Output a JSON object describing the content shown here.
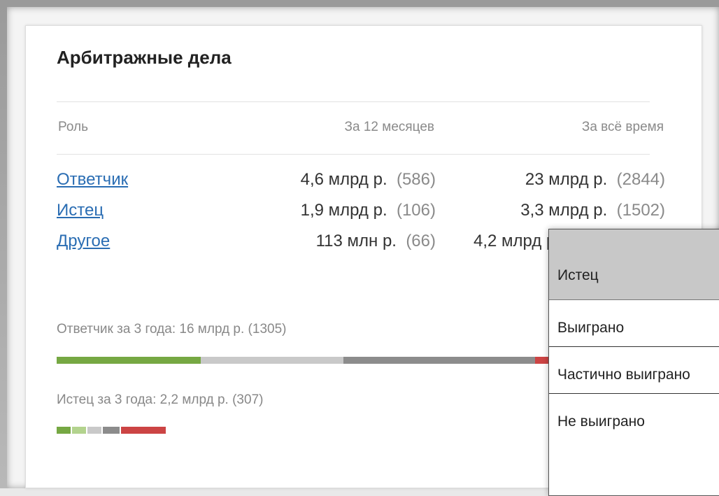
{
  "card": {
    "title": "Арбитражные дела",
    "columns": {
      "role": "Роль",
      "last12": "За 12 месяцев",
      "all_time": "За всё время"
    },
    "rows": [
      {
        "role": "Ответчик",
        "last12_amount": "4,6 млрд р.",
        "last12_count": "(586)",
        "all_amount": "23 млрд р.",
        "all_count": "(2844)"
      },
      {
        "role": "Истец",
        "last12_amount": "1,9 млрд р.",
        "last12_count": "(106)",
        "all_amount": "3,3 млрд р.",
        "all_count": "(1502)"
      },
      {
        "role": "Другое",
        "last12_amount": "113 млн р.",
        "last12_count": "(66)",
        "all_amount": "4,2 млрд р.",
        "all_count": ""
      }
    ],
    "defendant_summary": "Ответчик за 3 года: 16 млрд р. (1305)",
    "plaintiff_summary": "Истец за 3 года: 2,2 млрд р. (307)"
  },
  "colors": {
    "won": "#76a843",
    "partial": "#b3d38e",
    "light_gray": "#c9c9c9",
    "dark_gray": "#8c8c8c",
    "lost": "#cc4444"
  },
  "popup": {
    "header": "Истец",
    "items": [
      "Выиграно",
      "Частично выиграно",
      "Не выиграно"
    ]
  }
}
